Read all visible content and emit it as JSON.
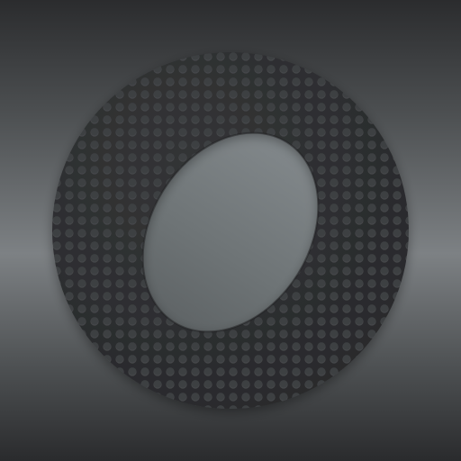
{
  "icon": {
    "name": "ring-logo-icon",
    "background_gradient": [
      "#2b2c2e",
      "#4d5052",
      "#7d8184",
      "#4d5052",
      "#2a2b2d"
    ],
    "ring_color": "#2e2f31",
    "dot_color": "#45474a",
    "hole_gradient": [
      "#82888b",
      "#6e7476",
      "#5f6466"
    ]
  }
}
